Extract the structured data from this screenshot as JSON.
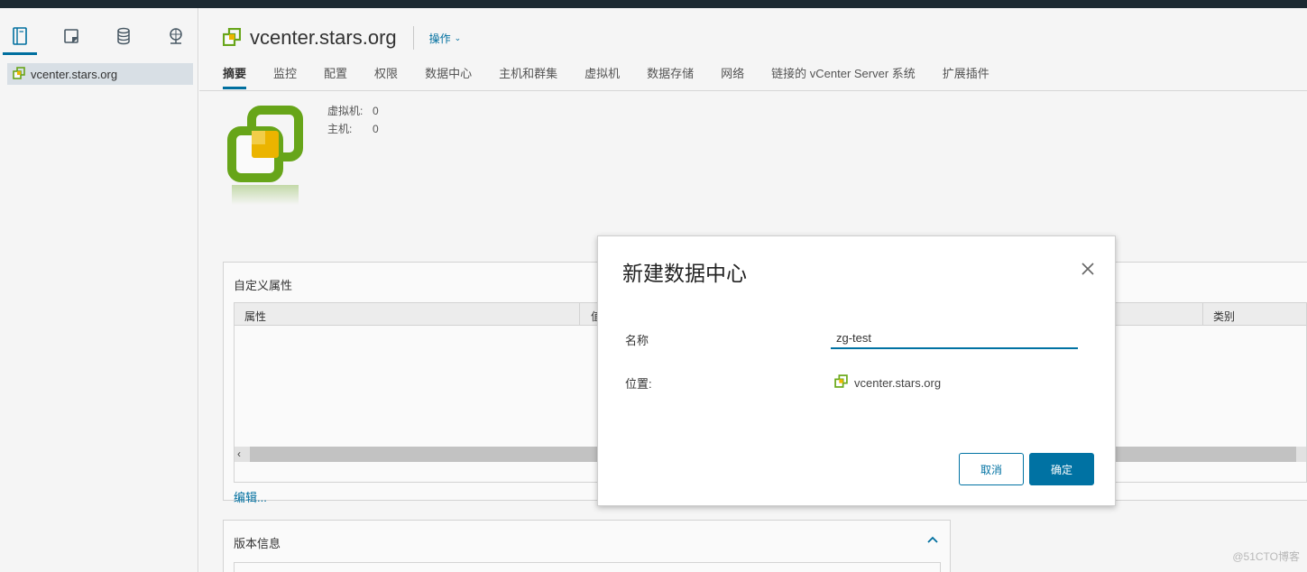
{
  "navigator": {
    "icons": [
      "hosts-clusters-icon",
      "vms-templates-icon",
      "storage-icon",
      "networking-icon"
    ],
    "tree_item": "vcenter.stars.org"
  },
  "header": {
    "title": "vcenter.stars.org",
    "actions_label": "操作"
  },
  "tabs": [
    "摘要",
    "监控",
    "配置",
    "权限",
    "数据中心",
    "主机和群集",
    "虚拟机",
    "数据存储",
    "网络",
    "链接的 vCenter Server 系统",
    "扩展插件"
  ],
  "summary": {
    "vm_label": "虚拟机:",
    "vm_value": "0",
    "host_label": "主机:",
    "host_value": "0"
  },
  "custom_attributes": {
    "title": "自定义属性",
    "col_attribute": "属性",
    "col_value": "值",
    "col_category": "类别",
    "edit_link": "编辑..."
  },
  "version_info": {
    "title": "版本信息"
  },
  "dialog": {
    "title": "新建数据中心",
    "name_label": "名称",
    "name_value": "zg-test",
    "location_label": "位置:",
    "location_value": "vcenter.stars.org",
    "cancel_label": "取消",
    "ok_label": "确定"
  },
  "watermark": "@51CTO博客",
  "colors": {
    "accent": "#0072a3",
    "topbar": "#1d2a33",
    "datacenter_green": "#6aa91a"
  }
}
